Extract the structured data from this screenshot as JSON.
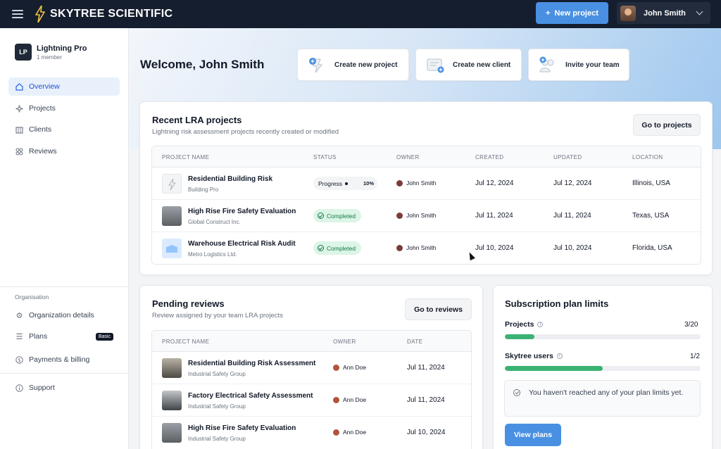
{
  "topbar": {
    "brand": "Skytree Scientific",
    "new_project_label": "New project",
    "user_name": "John Smith",
    "icons": {
      "menu": "hamburger-icon",
      "logo": "lightning-bolt-icon",
      "chevron": "chevron-down-icon"
    }
  },
  "sidebar": {
    "org_badge": "LP",
    "org_name": "Lightning Pro",
    "org_members": "1 member",
    "nav": [
      {
        "label": "Overview",
        "icon": "home-icon",
        "active": true
      },
      {
        "label": "Projects",
        "icon": "sparkle-icon"
      },
      {
        "label": "Clients",
        "icon": "building-icon"
      },
      {
        "label": "Reviews",
        "icon": "grid-icon"
      }
    ],
    "section_label": "Organisation",
    "org_nav": [
      {
        "label": "Organization details",
        "icon": "gear-icon"
      },
      {
        "label": "Plans",
        "icon": "list-icon",
        "badge": "Basic"
      },
      {
        "label": "Payments & billing",
        "icon": "dollar-icon"
      }
    ],
    "support_label": "Support"
  },
  "main": {
    "welcome": "Welcome, John Smith",
    "quick_actions": [
      {
        "label": "Create new project"
      },
      {
        "label": "Create new client"
      },
      {
        "label": "Invite your team"
      }
    ]
  },
  "recent": {
    "title": "Recent LRA projects",
    "subtitle": "Lightning risk assessment projects recently created or modified",
    "button": "Go to projects",
    "columns": [
      "PROJECT NAME",
      "STATUS",
      "OWNER",
      "CREATED",
      "UPDATED",
      "LOCATION"
    ],
    "rows": [
      {
        "name": "Residential Building Risk",
        "client": "Building Pro",
        "status": "Progress",
        "progress_pct": "10%",
        "owner": "John Smith",
        "created": "Jul 12, 2024",
        "updated": "Jul 12, 2024",
        "location": "Illinois, USA"
      },
      {
        "name": "High Rise Fire Safety Evaluation",
        "client": "Global Construct Inc.",
        "status": "Completed",
        "owner": "John Smith",
        "created": "Jul 11, 2024",
        "updated": "Jul 11, 2024",
        "location": "Texas, USA"
      },
      {
        "name": "Warehouse Electrical Risk Audit",
        "client": "Metro Logistics Ltd.",
        "status": "Completed",
        "owner": "John Smith",
        "created": "Jul 10, 2024",
        "updated": "Jul 10, 2024",
        "location": "Florida, USA"
      }
    ]
  },
  "pending": {
    "title": "Pending reviews",
    "subtitle": "Review assigned by your team LRA projects",
    "button": "Go to reviews",
    "columns": [
      "PROJECT NAME",
      "OWNER",
      "DATE"
    ],
    "rows": [
      {
        "name": "Residential Building Risk Assessment",
        "client": "Industrial Safety Group",
        "owner": "Ann Doe",
        "date": "Jul 11, 2024"
      },
      {
        "name": "Factory Electrical Safety Assessment",
        "client": "Industrial Safety Group",
        "owner": "Ann Doe",
        "date": "Jul 11, 2024"
      },
      {
        "name": "High Rise Fire Safety Evaluation",
        "client": "Industrial Safety Group",
        "owner": "Ann Doe",
        "date": "Jul 10, 2024"
      }
    ]
  },
  "subscription": {
    "title": "Subscription plan limits",
    "limits": [
      {
        "label": "Projects",
        "count": "3/20",
        "fraction": 0.15
      },
      {
        "label": "Skytree users",
        "count": "1/2",
        "fraction": 0.5
      }
    ],
    "note": "You haven't reached any of your plan limits yet.",
    "button": "View plans",
    "bar_color": "#3bb273"
  },
  "colors": {
    "accent": "#4a90e2",
    "topbar": "#151e2e",
    "success": "#16794a"
  }
}
